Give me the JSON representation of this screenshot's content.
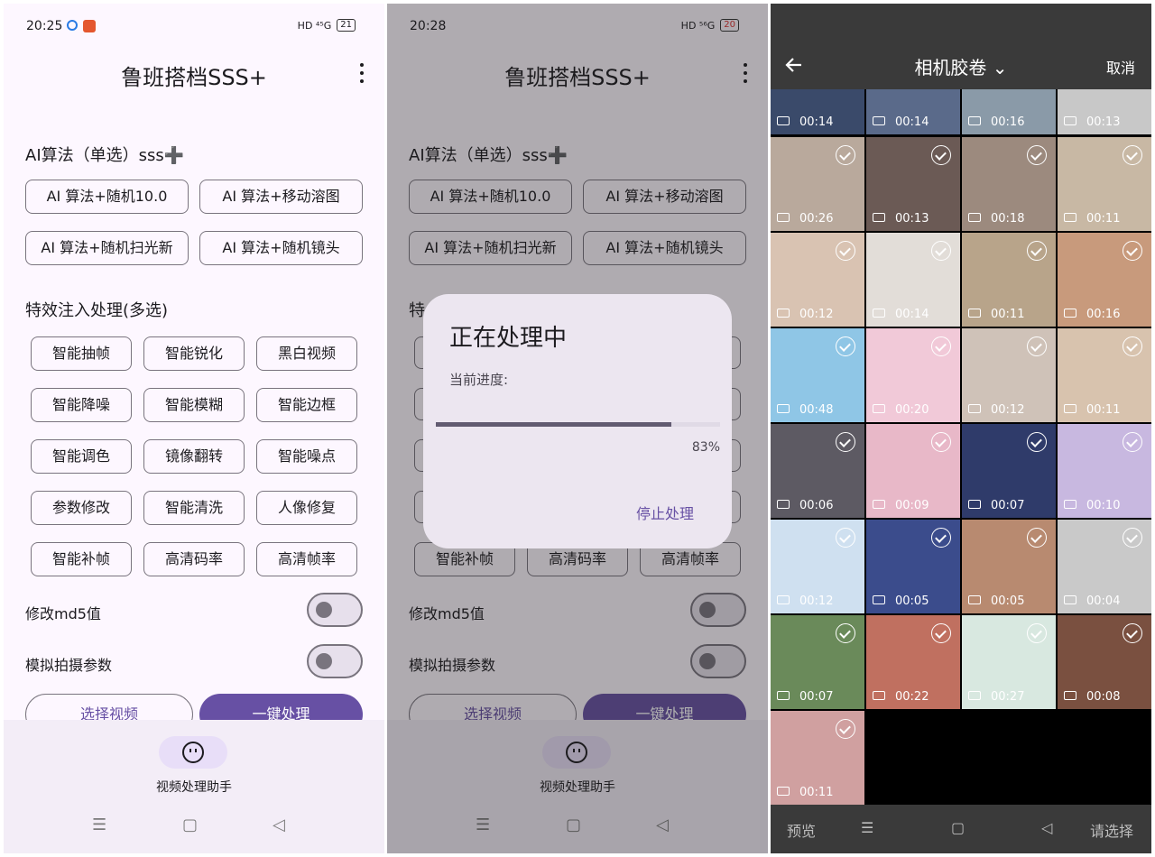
{
  "screen1": {
    "status": {
      "time": "20:25",
      "net": "HD ⁴⁵G",
      "battery": "21"
    },
    "title": "鲁班搭档SSS+",
    "algo_title": "AI算法（单选）sss➕",
    "algos": [
      "AI 算法+随机10.0",
      "AI 算法+移动溶图",
      "AI 算法+随机扫光新",
      "AI 算法+随机镜头"
    ],
    "fx_title": "特效注入处理(多选)",
    "effects": [
      "智能抽帧",
      "智能锐化",
      "黑白视频",
      "智能降噪",
      "智能模糊",
      "智能边框",
      "智能调色",
      "镜像翻转",
      "智能噪点",
      "参数修改",
      "智能清洗",
      "人像修复",
      "智能补帧",
      "高清码率",
      "高清帧率"
    ],
    "toggle_md5": "修改md5值",
    "toggle_sim": "模拟拍摄参数",
    "btn_select": "选择视频",
    "btn_process": "一键处理",
    "nav_label": "视频处理助手",
    "sysnav": {
      "menu": "☰",
      "home": "▢",
      "back": "◁"
    }
  },
  "screen2": {
    "status": {
      "time": "20:28",
      "net": "HD ⁵⁶G",
      "battery": "20"
    },
    "title": "鲁班搭档SSS+",
    "algo_title": "AI算法（单选）sss➕",
    "algos": [
      "AI 算法+随机10.0",
      "AI 算法+移动溶图",
      "AI 算法+随机扫光新",
      "AI 算法+随机镜头"
    ],
    "fx_partial": "特",
    "effects_visible": [
      "智能补帧",
      "高清码率",
      "高清帧率"
    ],
    "toggle_md5": "修改md5值",
    "toggle_sim": "模拟拍摄参数",
    "btn_select": "选择视频",
    "btn_process": "一键处理",
    "nav_label": "视频处理助手",
    "dialog": {
      "title": "正在处理中",
      "subtitle": "当前进度:",
      "progress": 0.83,
      "percent_text": "83%",
      "stop": "停止处理"
    },
    "sysnav": {
      "menu": "☰",
      "home": "▢",
      "back": "◁"
    }
  },
  "screen3": {
    "back_icon": "arrow-left-icon",
    "title": "相机胶卷 ⌄",
    "cancel": "取消",
    "top_row": [
      "00:14",
      "00:14",
      "00:16",
      "00:13"
    ],
    "grid": [
      "00:26",
      "00:13",
      "00:18",
      "00:11",
      "00:12",
      "00:14",
      "00:11",
      "00:16",
      "00:48",
      "00:20",
      "00:12",
      "00:11",
      "00:06",
      "00:09",
      "00:07",
      "00:10",
      "00:12",
      "00:05",
      "00:05",
      "00:04",
      "00:07",
      "00:22",
      "00:27",
      "00:08",
      "00:11"
    ],
    "thumb_colors": [
      "#b9a99c",
      "#6b5a55",
      "#9c8a7e",
      "#c8b8a4",
      "#d9c3b2",
      "#e2ddd8",
      "#b8a48a",
      "#c89a7c",
      "#8fc6e6",
      "#f1c9d8",
      "#cfc2b8",
      "#d8c3ae",
      "#5d5a63",
      "#e8b8c8",
      "#2f3b6a",
      "#c8b8e0",
      "#cfe0f0",
      "#3b4c8c",
      "#b88a70",
      "#c9c9c9",
      "#6a8a5a",
      "#c07060",
      "#d8e8e0",
      "#7a5040",
      "#d0a0a0"
    ],
    "top_colors": [
      "#3a4a6a",
      "#5a6a8a",
      "#8a9aa8",
      "#c8c8c8"
    ],
    "bottom": {
      "preview": "预览",
      "menu": "☰",
      "home": "▢",
      "back": "◁",
      "select": "请选择"
    }
  }
}
